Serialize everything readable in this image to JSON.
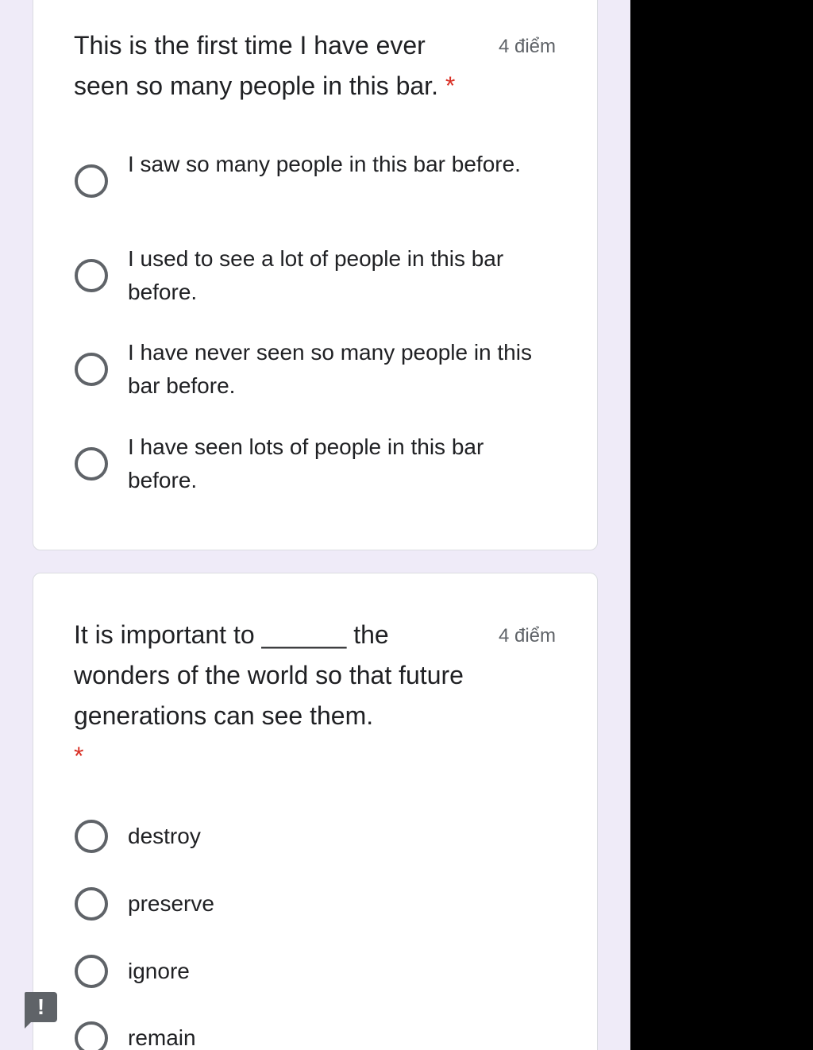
{
  "questions": [
    {
      "title": "This is the first time I have ever seen so many people in this bar.",
      "required_mark": "*",
      "points": "4 điểm",
      "options": [
        "I saw so many people in this bar before.",
        "I used to see a lot of people in this bar before.",
        "I have never seen so many people in this bar before.",
        "I have seen lots of people in this bar before."
      ]
    },
    {
      "title": "It is important to ______ the wonders of the world so that future generations can see them.",
      "required_mark": "*",
      "points": "4 điểm",
      "options": [
        "destroy",
        "preserve",
        "ignore",
        "remain"
      ]
    }
  ],
  "alert_tab": {
    "icon": "exclamation-icon",
    "glyph": "!"
  },
  "colors": {
    "page_background": "#efebf8",
    "card_background": "#ffffff",
    "required": "#d93025",
    "radio_border": "#5f6368",
    "text": "#202124",
    "points_text": "#5f6368",
    "outside": "#000000"
  }
}
